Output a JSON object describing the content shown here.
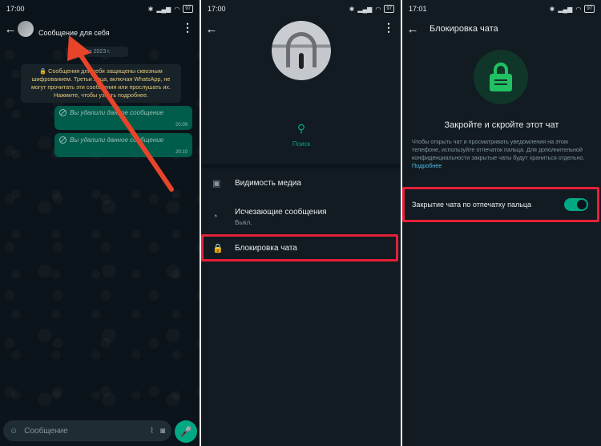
{
  "status_bars": [
    {
      "time": "17:00",
      "battery": "97"
    },
    {
      "time": "17:00",
      "battery": "97"
    },
    {
      "time": "17:01",
      "battery": "97"
    }
  ],
  "panel1": {
    "chat_title": "Сообщение для себя",
    "date_chip": "ста 2023 г.",
    "encryption_notice": "🔒 Сообщения для себя защищены сквозным шифрованием. Третьи лица, включая WhatsApp, не могут прочитать эти сообщения или прослушать их. Нажмите, чтобы узнать подробнее.",
    "messages": [
      {
        "text": "Вы удалили данное сообщение",
        "time": "20:09"
      },
      {
        "text": "Вы удалили данное сообщение",
        "time": "20:10"
      }
    ],
    "composer_placeholder": "Сообщение"
  },
  "panel2": {
    "search_label": "Поиск",
    "rows": [
      {
        "label": "Видимость медиа",
        "sub": ""
      },
      {
        "label": "Исчезающие сообщения",
        "sub": "Выкл."
      },
      {
        "label": "Блокировка чата",
        "sub": ""
      }
    ]
  },
  "panel3": {
    "title": "Блокировка чата",
    "heading": "Закройте и скройте этот чат",
    "description": "Чтобы открыть чат и просматривать уведомления на этом телефоне, используйте отпечаток пальца. Для дополнительной конфиденциальности закрытые чаты будут храниться отдельно.",
    "more_link": "Подробнее",
    "toggle_label": "Закрытие чата по отпечатку пальца",
    "toggle_on": true
  },
  "colors": {
    "accent": "#00a884",
    "highlight": "#e5203a",
    "arrow": "#e8442a"
  }
}
